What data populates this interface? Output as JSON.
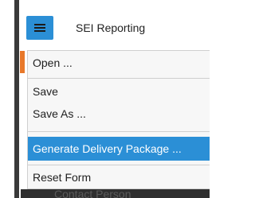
{
  "header": {
    "title": "SEI Reporting",
    "menu_icon": "hamburger-menu-icon"
  },
  "menu": {
    "items": [
      {
        "label": "Open ..."
      },
      {
        "label": "Save"
      },
      {
        "label": "Save As ..."
      },
      {
        "label": "Generate Delivery Package ...",
        "highlighted": true
      },
      {
        "label": "Reset Form"
      }
    ]
  },
  "background": {
    "partial_label": "Contact Person"
  },
  "colors": {
    "accent": "#2b8fd6",
    "menu_background": "#f7f7f7",
    "orange_tab": "#e8782a"
  }
}
